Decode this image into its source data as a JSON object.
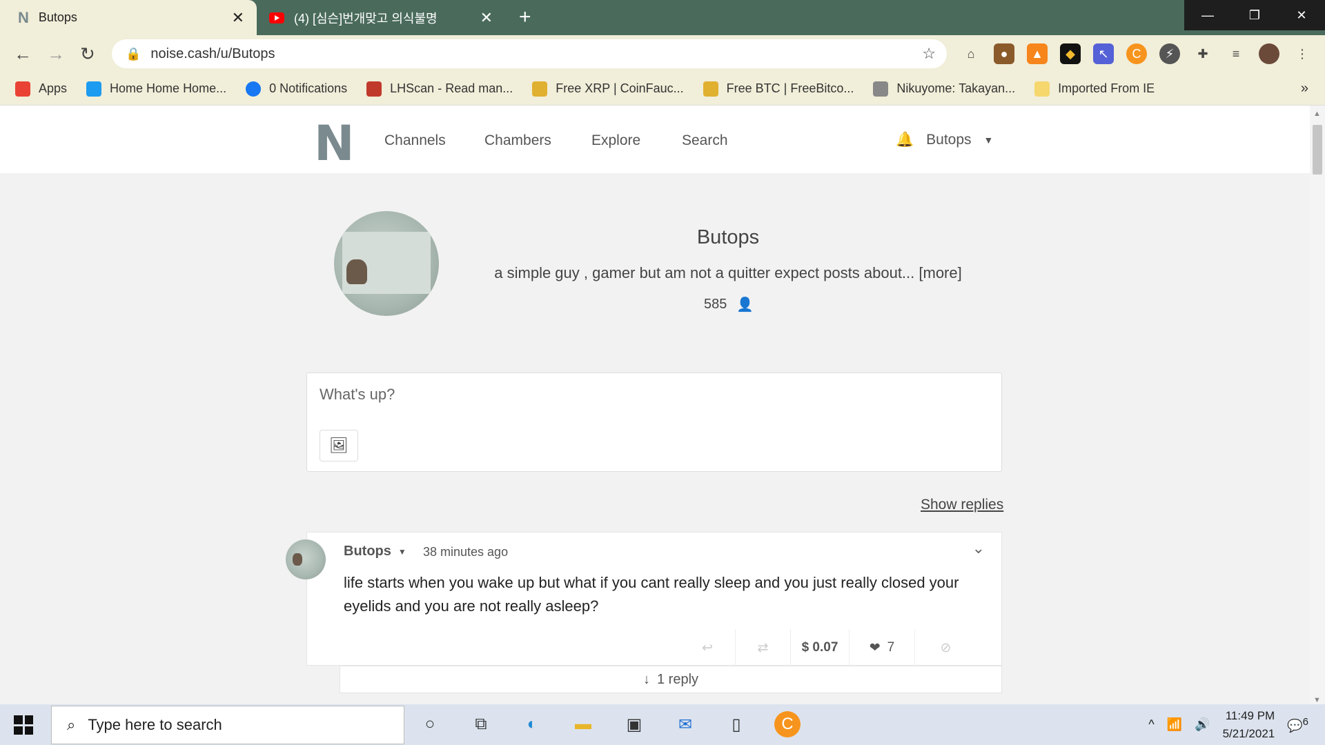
{
  "browser": {
    "tabs": [
      {
        "title": "Butops",
        "active": true,
        "close": "✕"
      },
      {
        "title": "(4) [심슨]번개맞고 의식불명",
        "active": false,
        "close": "✕"
      }
    ],
    "new_tab": "+",
    "window_controls": {
      "minimize": "—",
      "restore": "❐",
      "close": "✕"
    },
    "url": "noise.cash/u/Butops",
    "bookmarks": [
      {
        "label": "Apps",
        "color": "#e94235"
      },
      {
        "label": "Home Home Home...",
        "color": "#1d9bf0"
      },
      {
        "label": "0 Notifications",
        "color": "#1877f2"
      },
      {
        "label": "LHScan - Read man...",
        "color": "#c0392b"
      },
      {
        "label": "Free XRP | CoinFauc...",
        "color": "#e0b030"
      },
      {
        "label": "Free BTC | FreeBitco...",
        "color": "#e0b030"
      },
      {
        "label": "Nikuyome: Takayan...",
        "color": "#888888"
      },
      {
        "label": "Imported From IE",
        "color": "#f5d76e"
      }
    ],
    "bookmarks_more": "»"
  },
  "site": {
    "logo": "N",
    "nav": [
      "Channels",
      "Chambers",
      "Explore",
      "Search"
    ],
    "user_menu_label": "Butops"
  },
  "profile": {
    "name": "Butops",
    "bio": "a simple guy , gamer but am not a quitter expect posts about... [more]",
    "followers": "585"
  },
  "composer": {
    "placeholder": "What's up?"
  },
  "feed": {
    "show_replies": "Show replies",
    "post": {
      "author": "Butops",
      "time": "38 minutes ago",
      "text": "life starts when you wake up but what if you cant really sleep and you just really closed your eyelids and you are not really asleep?",
      "tip_amount": "$ 0.07",
      "likes": "7",
      "replies": "1 reply"
    }
  },
  "taskbar": {
    "search_placeholder": "Type here to search",
    "time": "11:49 PM",
    "date": "5/21/2021",
    "notification_count": "6"
  }
}
